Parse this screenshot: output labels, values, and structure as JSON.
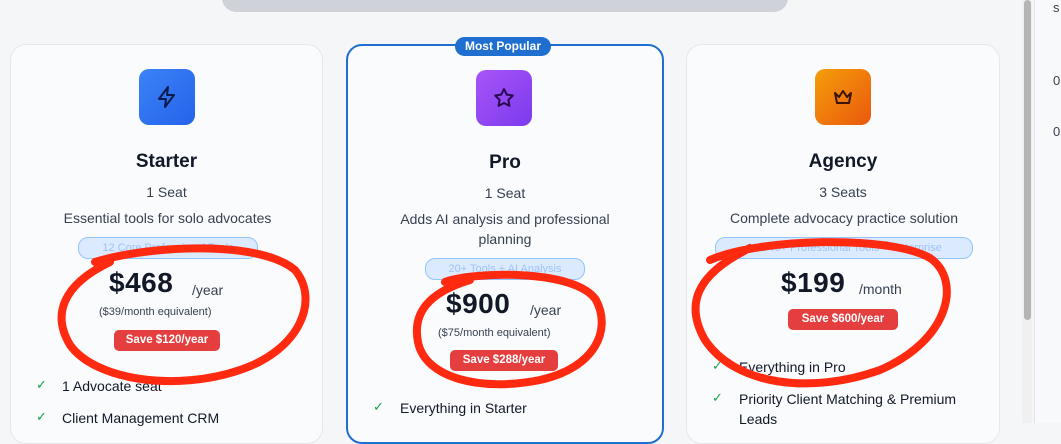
{
  "plans": [
    {
      "icon": "lightning-icon",
      "name": "Starter",
      "seats": "1 Seat",
      "description": "Essential tools for solo advocates",
      "tools_pill": "12 Core Professional Tools",
      "price": "$468",
      "period": "/year",
      "equivalent": "($39/month equivalent)",
      "save": "Save $120/year",
      "features": [
        "1 Advocate seat",
        "Client Management CRM"
      ]
    },
    {
      "icon": "star-icon",
      "name": "Pro",
      "seats": "1 Seat",
      "description_lines": [
        "Adds AI analysis and professional",
        "planning"
      ],
      "tools_pill": "20+ Tools + AI Analysis",
      "price": "$900",
      "period": "/year",
      "equivalent": "($75/month equivalent)",
      "save": "Save $288/year",
      "features": [
        "Everything in Starter"
      ]
    },
    {
      "icon": "crown-icon",
      "name": "Agency",
      "seats": "3 Seats",
      "description": "Complete advocacy practice solution",
      "tools_pill": "ALL 40+ Professional Tools + Enterprise",
      "price": "$199",
      "period": "/month",
      "save": "Save $600/year",
      "features": [
        "Everything in Pro",
        "Priority Client Matching & Premium",
        "Leads"
      ]
    }
  ],
  "badge": "Most Popular",
  "side_panel": {
    "top": "s",
    "row1": "0",
    "row2": "0"
  },
  "colors": {
    "accent_blue": "#1f6fd1",
    "save_red": "#e53e3e",
    "annotation_red": "#ff2a10",
    "check_green": "#16a34a"
  }
}
